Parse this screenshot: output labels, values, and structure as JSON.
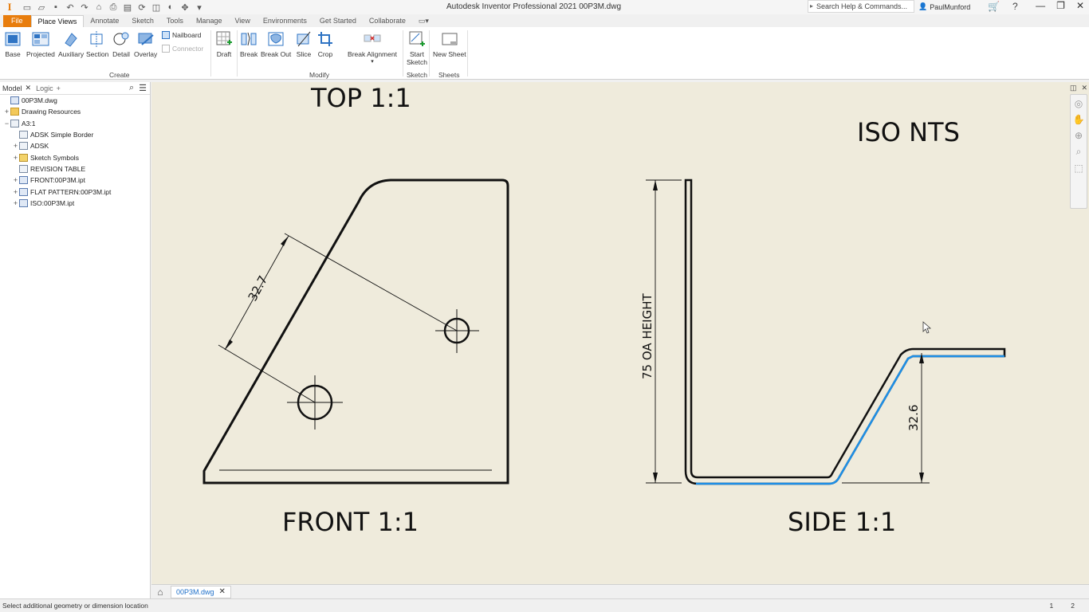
{
  "window": {
    "title": "Autodesk Inventor Professional 2021   00P3M.dwg",
    "search_placeholder": "Search Help & Commands...",
    "user": "PaulMunford"
  },
  "tabs": [
    "File",
    "Place Views",
    "Annotate",
    "Sketch",
    "Tools",
    "Manage",
    "View",
    "Environments",
    "Get Started",
    "Collaborate"
  ],
  "ribbon": {
    "create": {
      "label": "Create",
      "buttons": [
        "Base",
        "Projected",
        "Auxiliary",
        "Section",
        "Detail",
        "Overlay"
      ],
      "nailboard": "Nailboard",
      "connector": "Connector",
      "draft": "Draft"
    },
    "modify": {
      "label": "Modify",
      "buttons": [
        "Break",
        "Break Out",
        "Slice",
        "Crop"
      ],
      "break_alignment": "Break Alignment"
    },
    "sketch": {
      "label": "Sketch",
      "start": "Start",
      "sketch": "Sketch"
    },
    "sheets": {
      "label": "Sheets",
      "new_sheet": "New Sheet"
    }
  },
  "browser": {
    "tab_model": "Model",
    "tab_logic": "Logic",
    "tree": [
      {
        "label": "00P3M.dwg",
        "depth": 0,
        "expander": "",
        "icon": "doc"
      },
      {
        "label": "Drawing Resources",
        "depth": 0,
        "expander": "+",
        "icon": "folder"
      },
      {
        "label": "A3:1",
        "depth": 0,
        "expander": "−",
        "icon": "sheet"
      },
      {
        "label": "ADSK Simple Border",
        "depth": 1,
        "expander": "",
        "icon": "sheet"
      },
      {
        "label": "ADSK",
        "depth": 1,
        "expander": "+",
        "icon": "sheet"
      },
      {
        "label": "Sketch Symbols",
        "depth": 1,
        "expander": "+",
        "icon": "sym"
      },
      {
        "label": "REVISION TABLE",
        "depth": 1,
        "expander": "",
        "icon": "sheet"
      },
      {
        "label": "FRONT:00P3M.ipt",
        "depth": 1,
        "expander": "+",
        "icon": "doc"
      },
      {
        "label": "FLAT PATTERN:00P3M.ipt",
        "depth": 1,
        "expander": "+",
        "icon": "doc"
      },
      {
        "label": "ISO:00P3M.ipt",
        "depth": 1,
        "expander": "+",
        "icon": "doc"
      }
    ]
  },
  "drawing": {
    "top_label": "TOP 1:1",
    "iso_label": "ISO NTS",
    "front_label": "FRONT 1:1",
    "side_label": "SIDE 1:1",
    "dim_diag": "32.7",
    "dim_height": "75 OA HEIGHT",
    "dim_rise": "32.6",
    "accent_color": "#1e8fe6"
  },
  "doc_tab": "00P3M.dwg",
  "status": {
    "message": "Select additional geometry or dimension location",
    "count_left": "1",
    "count_right": "2"
  }
}
